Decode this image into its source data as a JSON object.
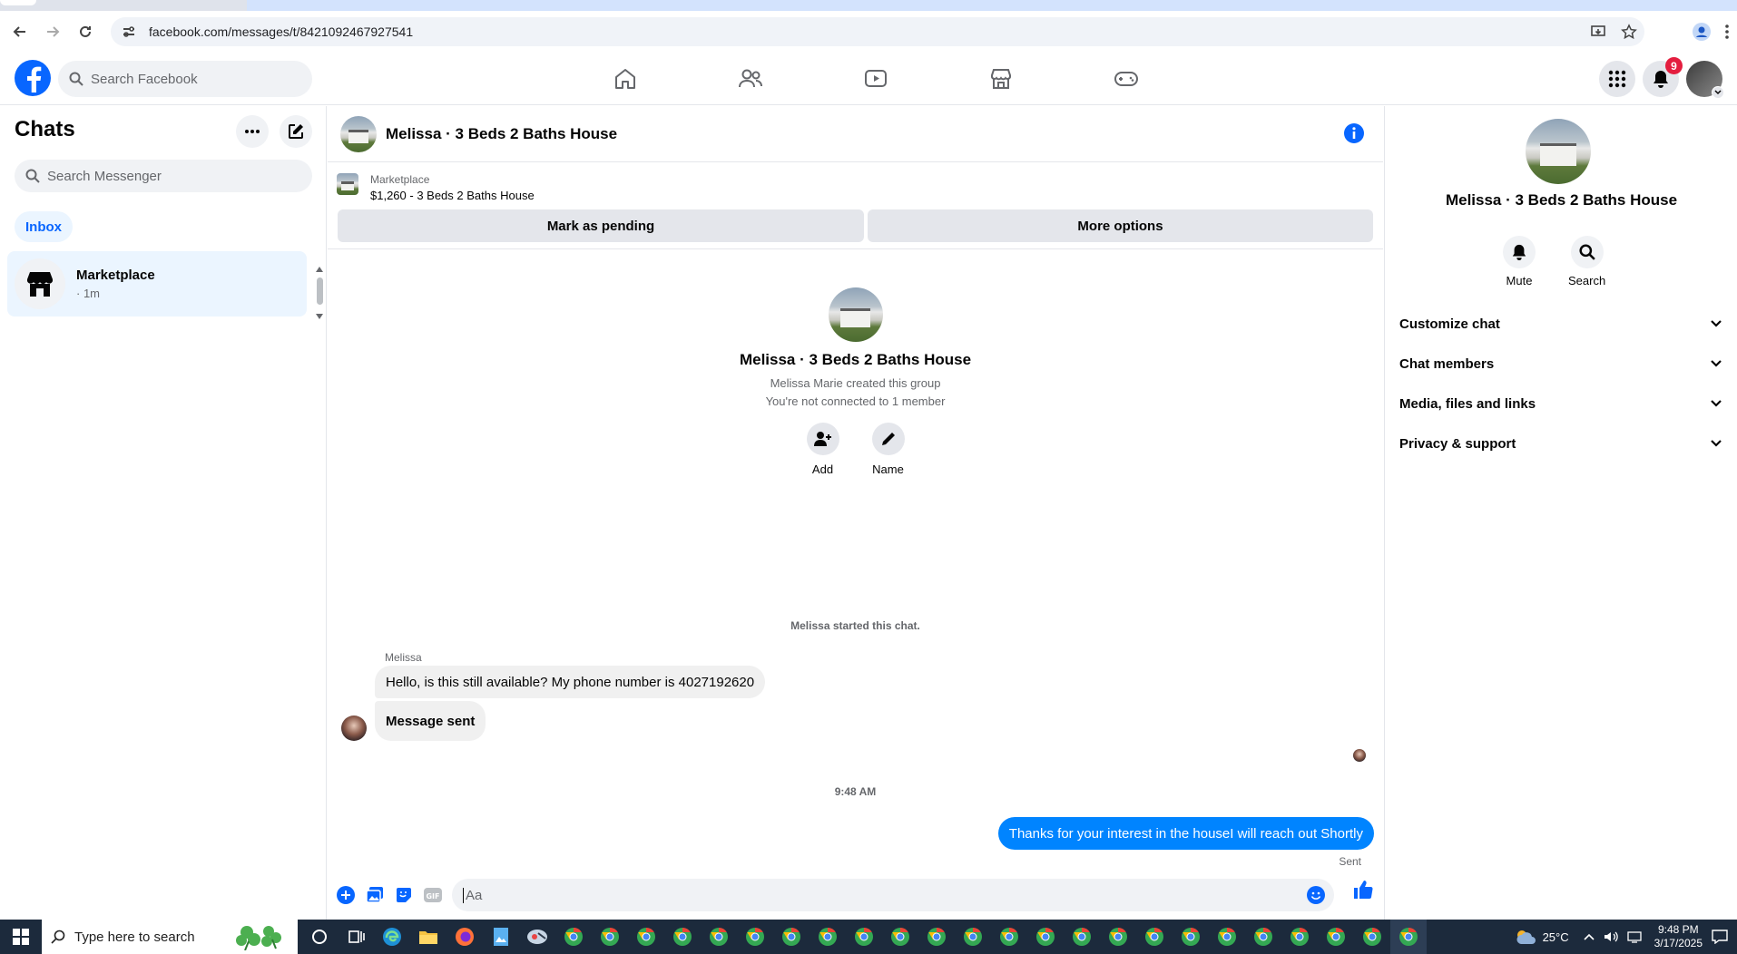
{
  "browser": {
    "url": "facebook.com/messages/t/8421092467927541"
  },
  "fb_header": {
    "search_placeholder": "Search Facebook",
    "notifications_count": "9"
  },
  "chats": {
    "title": "Chats",
    "search_placeholder": "Search Messenger",
    "filter_label": "Inbox",
    "items": [
      {
        "name": "Marketplace",
        "time": "· 1m"
      }
    ]
  },
  "conversation": {
    "title": "Melissa · 3 Beds 2 Baths House",
    "marketplace_label": "Marketplace",
    "listing": "$1,260 - 3 Beds 2 Baths House",
    "mark_pending_label": "Mark as pending",
    "more_options_label": "More options",
    "intro": {
      "title": "Melissa · 3 Beds 2 Baths House",
      "created": "Melissa Marie created this group",
      "connection": "You're not connected to 1 member",
      "add_label": "Add",
      "name_label": "Name"
    },
    "system_message": "Melissa started this chat.",
    "sender_name": "Melissa",
    "messages_in": [
      "Hello, is this still available? My phone number is 4027192620",
      "Message sent"
    ],
    "time_separator": "9:48 AM",
    "message_out": "Thanks for your interest in the houseI will reach out Shortly",
    "sent_status": "Sent",
    "composer_placeholder": "Aa"
  },
  "details_panel": {
    "title": "Melissa · 3 Beds 2 Baths House",
    "mute_label": "Mute",
    "search_label": "Search",
    "sections": [
      "Customize chat",
      "Chat members",
      "Media, files and links",
      "Privacy & support"
    ]
  },
  "taskbar": {
    "search_placeholder": "Type here to search",
    "temperature": "25°C",
    "time": "9:48 PM",
    "date": "3/17/2025"
  },
  "colors": {
    "brand": "#0866ff",
    "outgoing_bubble": "#0084ff",
    "badge": "#e41e3f"
  }
}
